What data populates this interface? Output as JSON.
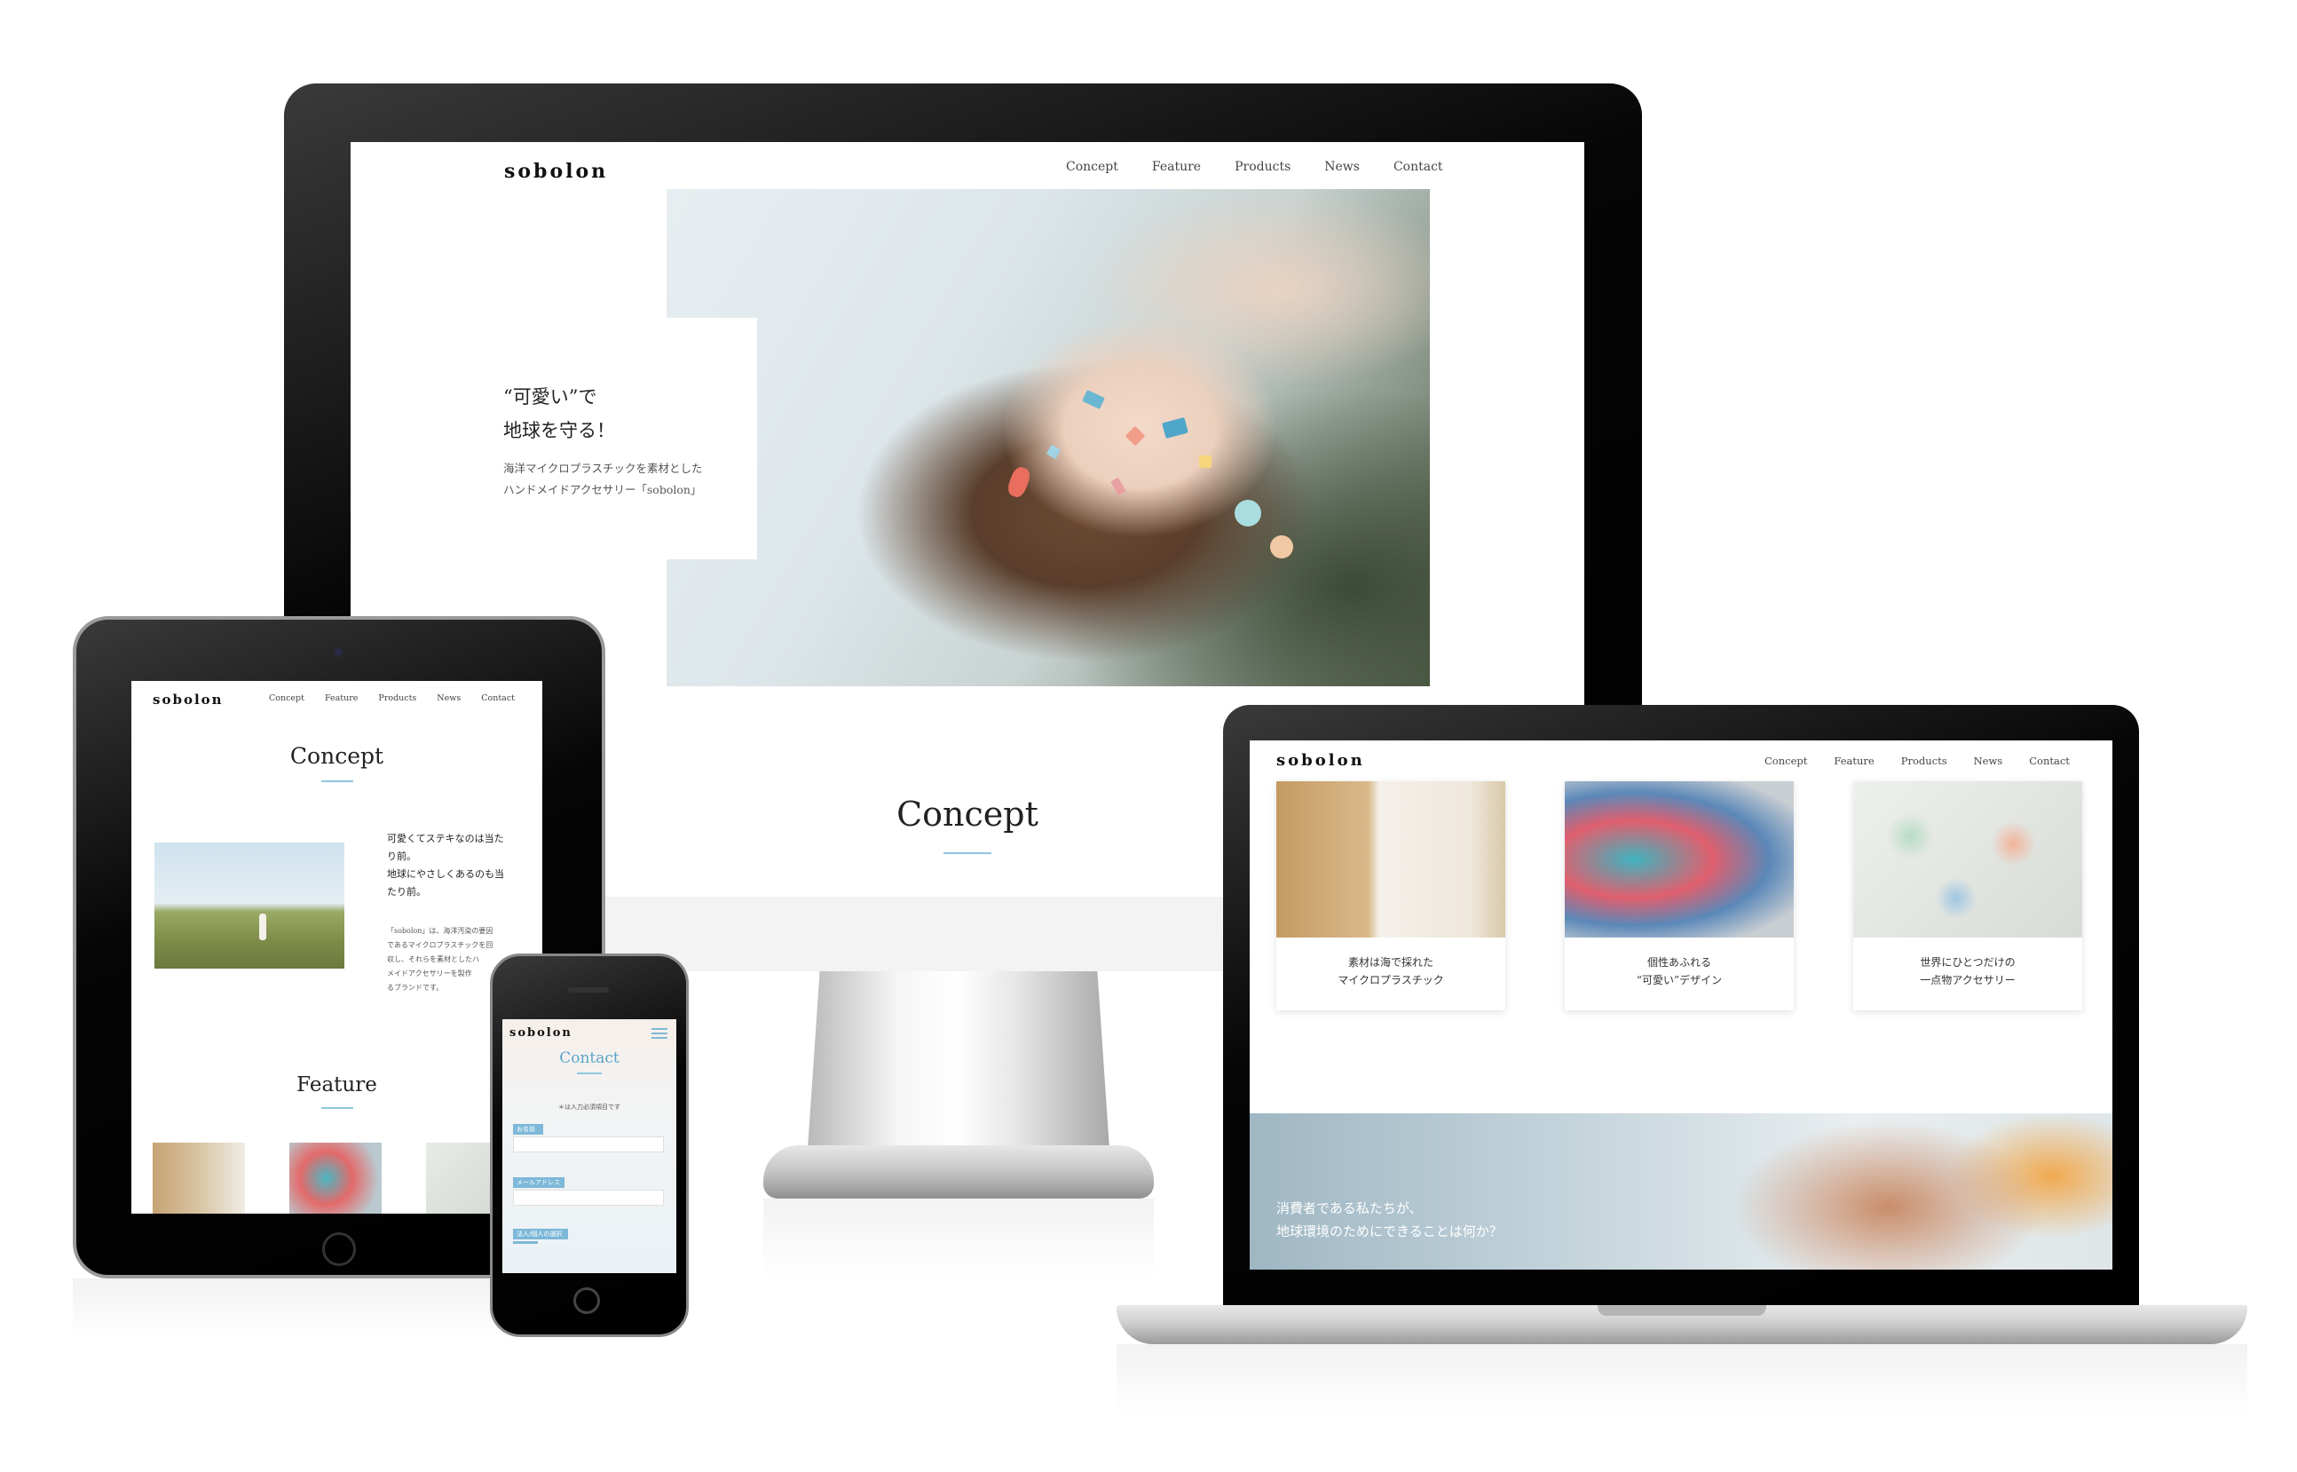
{
  "brand": "sobolon",
  "nav": [
    "Concept",
    "Feature",
    "Products",
    "News",
    "Contact"
  ],
  "hero": {
    "title_line1": "“可愛い”で",
    "title_line2": "地球を守る！",
    "desc_line1": "海洋マイクロプラスチックを素材とした",
    "desc_line2": "ハンドメイドアクセサリー「sobolon」"
  },
  "monitor": {
    "section_title": "Concept"
  },
  "tablet": {
    "concept_title": "Concept",
    "concept_lead_1": "可愛くてステキなのは当た",
    "concept_lead_2": "り前。",
    "concept_lead_3": "地球にやさしくあるのも当",
    "concept_lead_4": "たり前。",
    "concept_body_1": "「sobolon」は、海洋汚染の要因",
    "concept_body_2": "であるマイクロプラスチックを回",
    "concept_body_3": "収し、それらを素材としたハ",
    "concept_body_4": "メイドアクセサリーを製作",
    "concept_body_5": "るブランドです。",
    "feature_title": "Feature"
  },
  "phone": {
    "section_title": "Contact",
    "required_note": "＊は入力必須項目です",
    "field_name": "お名前",
    "field_email": "メールアドレス",
    "field_type": "法人/個人の選択"
  },
  "laptop": {
    "cards": [
      {
        "line1": "素材は海で採れた",
        "line2": "マイクロプラスチック"
      },
      {
        "line1": "個性あふれる",
        "line2": "“可愛い”デザイン"
      },
      {
        "line1": "世界にひとつだけの",
        "line2": "一点物アクセサリー"
      }
    ],
    "banner_line1": "消費者である私たちが、",
    "banner_line2": "地球環境のためにできることは何か？"
  },
  "colors": {
    "accent": "#8fc6e0",
    "form_label": "#7db8d8",
    "bezel": "#000000"
  },
  "icons": [
    "hamburger-menu-icon"
  ]
}
